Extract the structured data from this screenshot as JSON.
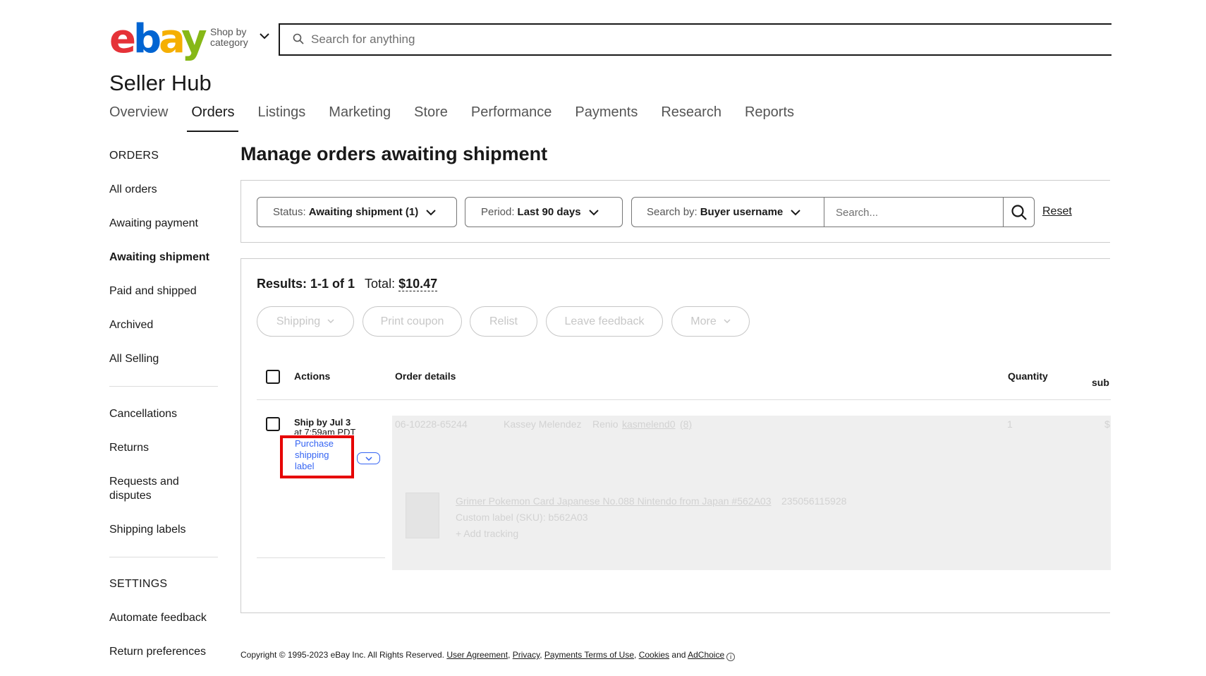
{
  "header": {
    "logo": {
      "e": "e",
      "b": "b",
      "a": "a",
      "y": "y"
    },
    "shop_by_line1": "Shop by",
    "shop_by_line2": "category",
    "search_placeholder": "Search for anything"
  },
  "hub_title": "Seller Hub",
  "tabs": [
    {
      "label": "Overview"
    },
    {
      "label": "Orders",
      "active": true
    },
    {
      "label": "Listings"
    },
    {
      "label": "Marketing"
    },
    {
      "label": "Store"
    },
    {
      "label": "Performance"
    },
    {
      "label": "Payments"
    },
    {
      "label": "Research"
    },
    {
      "label": "Reports"
    }
  ],
  "sidebar": {
    "orders_heading": "ORDERS",
    "orders_items": [
      "All orders",
      "Awaiting payment",
      "Awaiting shipment",
      "Paid and shipped",
      "Archived",
      "All Selling"
    ],
    "other_items": [
      "Cancellations",
      "Returns",
      "Requests and disputes",
      "Shipping labels"
    ],
    "settings_heading": "SETTINGS",
    "settings_items": [
      "Automate feedback",
      "Return preferences"
    ]
  },
  "main_title": "Manage orders awaiting shipment",
  "filters": {
    "status_label": "Status:",
    "status_value": "Awaiting shipment (1)",
    "period_label": "Period:",
    "period_value": "Last 90 days",
    "search_by_label": "Search by:",
    "search_by_value": "Buyer username",
    "search_placeholder": "Search...",
    "reset_label": "Reset"
  },
  "results": {
    "results_label": "Results: 1-1 of 1",
    "total_label": "Total:",
    "total_value": "$10.47"
  },
  "actions": {
    "shipping": "Shipping",
    "print_coupon": "Print coupon",
    "relist": "Relist",
    "leave_feedback": "Leave feedback",
    "more": "More"
  },
  "table": {
    "col_actions": "Actions",
    "col_order_details": "Order details",
    "col_quantity": "Quantity",
    "col_sub": "sub"
  },
  "order_row": {
    "ship_by": "Ship by Jul 3",
    "ship_time": "at 7:59am PDT",
    "purchase_label": "Purchase shipping label",
    "order_number": "06-10228-65244",
    "buyer_name": "Kassey Melendez",
    "buyer_location": "Renio",
    "buyer_username": "kasmelend0",
    "feedback_score": "(8)",
    "quantity": "1",
    "sub": "$",
    "item_title": "Grimer Pokemon Card Japanese No.088 Nintendo from Japan #562A03",
    "item_number": "235056115928",
    "custom_label": "Custom label (SKU): b562A03",
    "add_tracking": "+ Add tracking"
  },
  "footer": {
    "copyright": "Copyright © 1995-2023 eBay Inc. All Rights Reserved.",
    "user_agreement": "User Agreement",
    "privacy": "Privacy",
    "payments_terms": "Payments Terms of Use",
    "cookies": "Cookies",
    "and": "and",
    "adchoice": "AdChoice"
  },
  "colors": {
    "text": "#191919",
    "link_blue": "#3665f3",
    "highlight_red": "#e60000",
    "disabled": "#c7c7c7"
  }
}
